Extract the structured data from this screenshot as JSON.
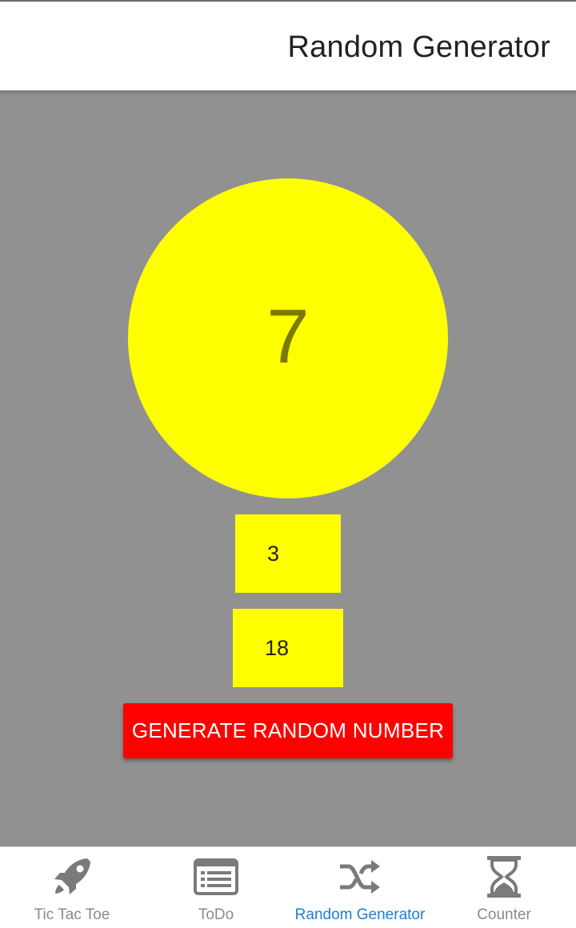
{
  "header": {
    "title": "Random Generator"
  },
  "generator": {
    "result": "7",
    "min_value": "3",
    "max_value": "18",
    "button_label": "GENERATE RANDOM NUMBER"
  },
  "tabs": [
    {
      "label": "Tic Tac Toe",
      "icon": "rocket-icon",
      "active": false
    },
    {
      "label": "ToDo",
      "icon": "list-icon",
      "active": false
    },
    {
      "label": "Random Generator",
      "icon": "shuffle-icon",
      "active": true
    },
    {
      "label": "Counter",
      "icon": "hourglass-icon",
      "active": false
    }
  ],
  "colors": {
    "background": "#919191",
    "circle": "#ffff00",
    "button": "#ff0000",
    "active_tab": "#1a7fd6",
    "inactive_tab": "#8a8a8a"
  }
}
